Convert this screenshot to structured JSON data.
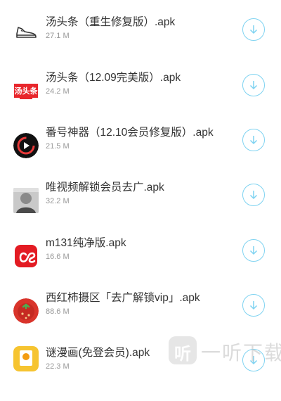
{
  "apps": [
    {
      "name": "汤头条（重生修复版）.apk",
      "size": "27.1 M",
      "icon": "shoe-icon"
    },
    {
      "name": "汤头条（12.09完美版）.apk",
      "size": "24.2 M",
      "icon": "tangtoutiao-logo-icon",
      "icon_text": "汤头条"
    },
    {
      "name": "番号神器（12.10会员修复版）.apk",
      "size": "21.5 M",
      "icon": "play-circle-icon"
    },
    {
      "name": "唯视频解锁会员去广.apk",
      "size": "32.2 M",
      "icon": "avatar-photo-icon"
    },
    {
      "name": "m131纯净版.apk",
      "size": "16.6 M",
      "icon": "lastfm-logo-icon"
    },
    {
      "name": "西红柿摄区「去广解锁vip」.apk",
      "size": "88.6 M",
      "icon": "tomato-icon"
    },
    {
      "name": "谜漫画(免登会员).apk",
      "size": "22.3 M",
      "icon": "comic-app-icon"
    }
  ],
  "colors": {
    "download_ring": "#7fd3f1",
    "name_text": "#333333",
    "size_text": "#999999"
  },
  "watermark": {
    "badge": "听",
    "text": "一听下载"
  }
}
